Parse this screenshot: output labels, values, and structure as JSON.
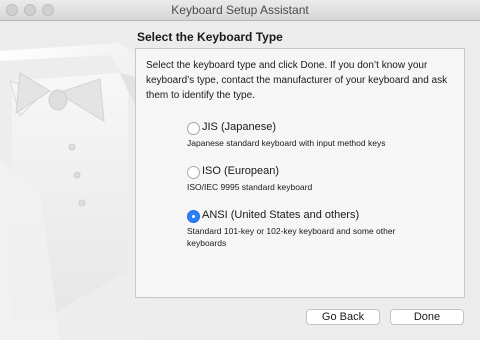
{
  "window": {
    "title": "Keyboard Setup Assistant"
  },
  "heading": "Select the Keyboard Type",
  "intro": "Select the keyboard type and click Done. If you don’t know your keyboard’s type, contact the manufacturer of your keyboard and ask them to identify the type.",
  "options": [
    {
      "label": "JIS (Japanese)",
      "description": "Japanese standard keyboard with input method keys",
      "selected": false
    },
    {
      "label": "ISO (European)",
      "description": "ISO/IEC 9995 standard keyboard",
      "selected": false
    },
    {
      "label": "ANSI (United States and others)",
      "description": "Standard 101-key or 102-key keyboard and some other keyboards",
      "selected": true
    }
  ],
  "buttons": {
    "back": "Go Back",
    "done": "Done"
  },
  "colors": {
    "accent": "#2d7ef6",
    "window_bg": "#ececec",
    "panel_bg": "#f6f6f6"
  }
}
